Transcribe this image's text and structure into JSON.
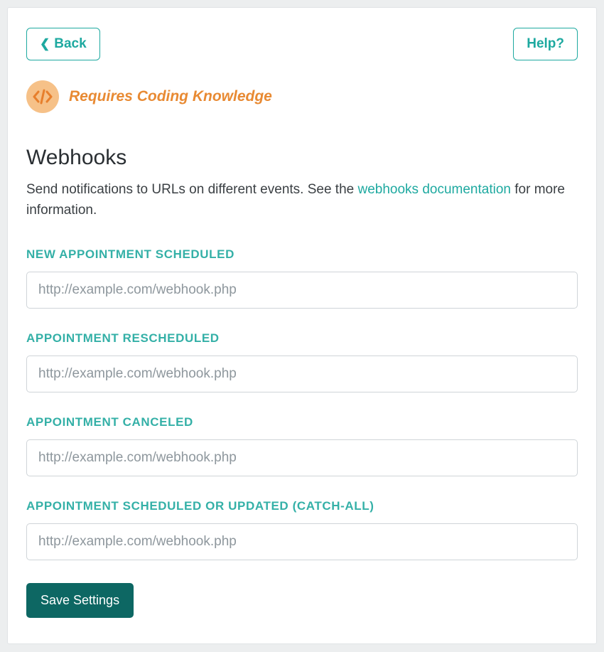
{
  "topbar": {
    "back_label": "Back",
    "help_label": "Help?"
  },
  "banner": {
    "coding_knowledge": "Requires Coding Knowledge"
  },
  "page": {
    "title": "Webhooks",
    "desc_prefix": "Send notifications to URLs on different events. See the ",
    "desc_link": "webhooks documentation",
    "desc_suffix": " for more information."
  },
  "fields": {
    "new_scheduled": {
      "label": "NEW APPOINTMENT SCHEDULED",
      "placeholder": "http://example.com/webhook.php",
      "value": ""
    },
    "rescheduled": {
      "label": "APPOINTMENT RESCHEDULED",
      "placeholder": "http://example.com/webhook.php",
      "value": ""
    },
    "canceled": {
      "label": "APPOINTMENT CANCELED",
      "placeholder": "http://example.com/webhook.php",
      "value": ""
    },
    "catch_all": {
      "label": "APPOINTMENT SCHEDULED OR UPDATED (CATCH-ALL)",
      "placeholder": "http://example.com/webhook.php",
      "value": ""
    }
  },
  "actions": {
    "save_label": "Save Settings"
  }
}
